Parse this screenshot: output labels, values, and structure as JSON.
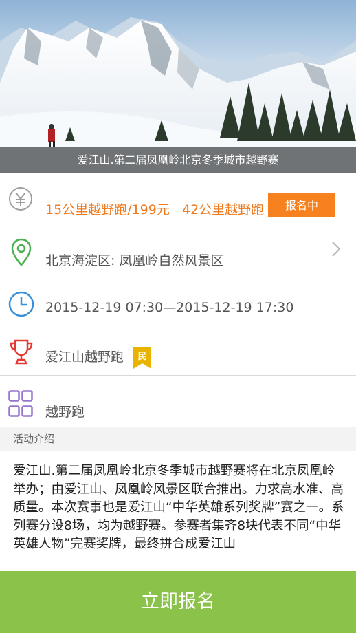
{
  "event": {
    "title": "爱江山.第二届凤凰岭北京冬季城市越野赛"
  },
  "price": {
    "option1": "15公里越野跑/199元",
    "option2": "42公里越野跑",
    "status_label": "报名中"
  },
  "location": {
    "text": "北京海淀区: 凤凰岭自然风景区"
  },
  "time": {
    "text": "2015-12-19 07:30—2015-12-19 17:30"
  },
  "organizer": {
    "name": "爱江山越野跑",
    "badge": "民"
  },
  "category": {
    "text": "越野跑"
  },
  "intro": {
    "header": "活动介绍",
    "body": "爱江山.第二届凤凰岭北京冬季城市越野赛将在北京凤凰岭举办；由爱江山、凤凰岭风景区联合推出。力求高水准、高质量。本次赛事也是爱江山“中华英雄系列奖牌”赛之一。系列赛分设8场，均为越野赛。参赛者集齐8块代表不同“中华英雄人物”完赛奖牌，最终拼合成爱江山"
  },
  "cta": {
    "label": "立即报名"
  },
  "icons": {
    "price": "yen-icon",
    "location": "map-pin-icon",
    "time": "clock-icon",
    "organizer": "trophy-icon",
    "category": "grid-icon",
    "chevron": "chevron-right-icon"
  },
  "colors": {
    "accent_orange": "#f7811f",
    "cta_green": "#8bc34a",
    "pin_green": "#4caf50",
    "clock_blue": "#3a8fd9",
    "trophy_red": "#e53935",
    "grid_purple": "#9575cd",
    "badge_gold": "#e8b400"
  }
}
